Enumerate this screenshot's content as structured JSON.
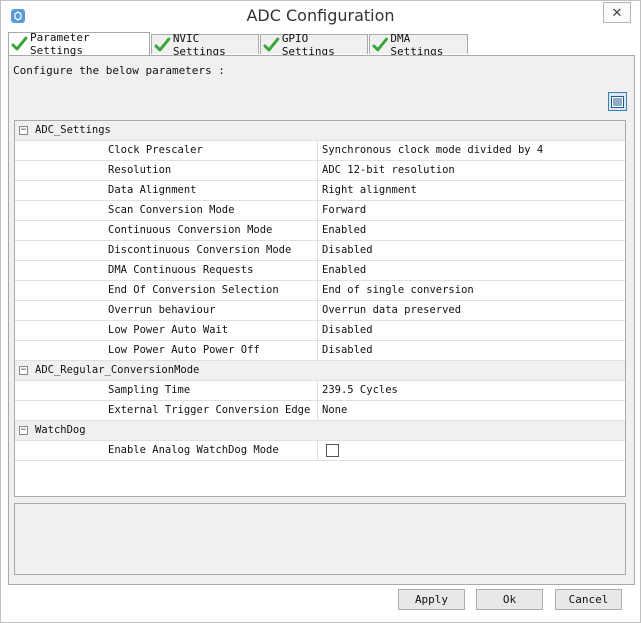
{
  "window": {
    "title": "ADC Configuration",
    "close_glyph": "✕"
  },
  "tabs": [
    {
      "label": "Parameter Settings",
      "active": true
    },
    {
      "label": "NVIC Settings",
      "active": false
    },
    {
      "label": "GPIO Settings",
      "active": false
    },
    {
      "label": "DMA Settings",
      "active": false
    }
  ],
  "panel": {
    "caption": "Configure the below parameters :"
  },
  "groups": [
    {
      "name": "ADC_Settings",
      "expander": "−",
      "params": [
        {
          "name": "Clock Prescaler",
          "value": "Synchronous clock mode divided by 4"
        },
        {
          "name": "Resolution",
          "value": "ADC 12-bit resolution"
        },
        {
          "name": "Data Alignment",
          "value": "Right alignment"
        },
        {
          "name": "Scan Conversion Mode",
          "value": "Forward"
        },
        {
          "name": "Continuous Conversion Mode",
          "value": "Enabled"
        },
        {
          "name": "Discontinuous Conversion Mode",
          "value": "Disabled"
        },
        {
          "name": "DMA Continuous Requests",
          "value": "Enabled"
        },
        {
          "name": "End Of Conversion Selection",
          "value": "End of single conversion"
        },
        {
          "name": "Overrun behaviour",
          "value": "Overrun data preserved"
        },
        {
          "name": "Low Power Auto Wait",
          "value": "Disabled"
        },
        {
          "name": "Low Power Auto Power Off",
          "value": "Disabled"
        }
      ]
    },
    {
      "name": "ADC_Regular_ConversionMode",
      "expander": "−",
      "params": [
        {
          "name": "Sampling Time",
          "value": "239.5 Cycles"
        },
        {
          "name": "External Trigger Conversion Edge",
          "value": "None"
        }
      ]
    },
    {
      "name": "WatchDog",
      "expander": "−",
      "params": [
        {
          "name": "Enable Analog WatchDog Mode",
          "value": "",
          "checkbox": true,
          "checked": false
        }
      ]
    }
  ],
  "buttons": {
    "apply": "Apply",
    "ok": "Ok",
    "cancel": "Cancel"
  },
  "colors": {
    "check_green": "#3aa53a",
    "accent_blue": "#3c7fb1"
  }
}
